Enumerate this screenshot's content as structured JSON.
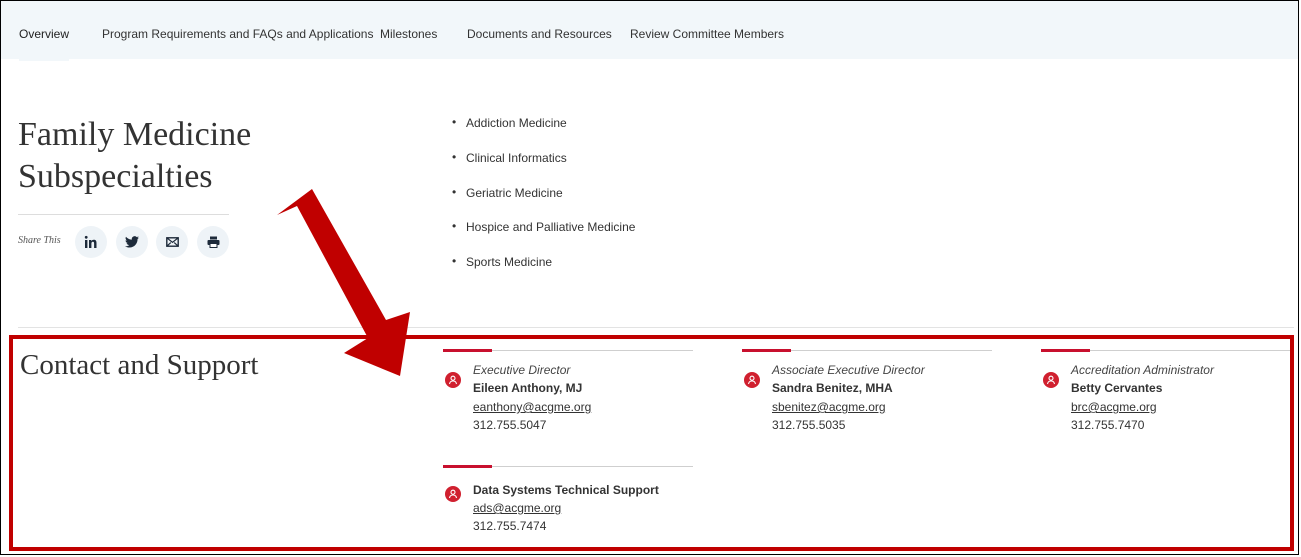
{
  "nav": {
    "tabs": [
      {
        "label": "Overview",
        "active": true
      },
      {
        "label": "Program Requirements and FAQs and Applications"
      },
      {
        "label": "Milestones"
      },
      {
        "label": "Documents and Resources"
      },
      {
        "label": "Review Committee Members"
      }
    ]
  },
  "page": {
    "title_line1": "Family Medicine",
    "title_line2": "Subspecialties",
    "share_label": "Share This",
    "share_icons": [
      "linkedin-icon",
      "twitter-icon",
      "email-icon",
      "print-icon"
    ]
  },
  "subspecialties": [
    "Addiction Medicine",
    "Clinical Informatics",
    "Geriatric Medicine",
    "Hospice and Palliative Medicine",
    "Sports Medicine"
  ],
  "contact": {
    "title": "Contact and Support",
    "people": [
      {
        "role": "Executive Director",
        "name": "Eileen Anthony, MJ",
        "email": "eanthony@acgme.org",
        "phone": "312.755.5047"
      },
      {
        "role": "Associate Executive Director",
        "name": "Sandra Benitez, MHA",
        "email": "sbenitez@acgme.org",
        "phone": "312.755.5035"
      },
      {
        "role": "Accreditation Administrator",
        "name": "Betty Cervantes",
        "email": "brc@acgme.org",
        "phone": "312.755.7470"
      },
      {
        "role": "",
        "name": "Data Systems Technical Support",
        "email": "ads@acgme.org",
        "phone": "312.755.7474"
      }
    ]
  },
  "colors": {
    "accent_red": "#c8102e",
    "annotation_red": "#c00000",
    "nav_bg": "#f2f7fa"
  }
}
